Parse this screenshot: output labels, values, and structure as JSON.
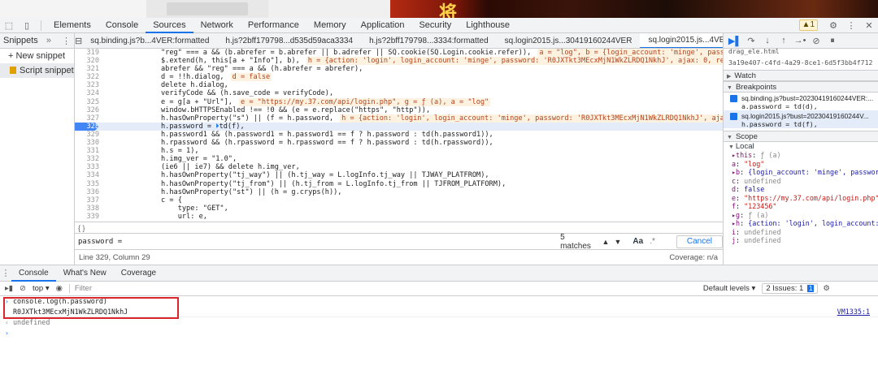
{
  "devtools": {
    "main_tabs": [
      "Elements",
      "Console",
      "Sources",
      "Network",
      "Performance",
      "Memory",
      "Application",
      "Security",
      "Lighthouse"
    ],
    "active_main_tab": "Sources",
    "warning_count": "1"
  },
  "navigator": {
    "tab_label": "Snippets",
    "new_snippet": "+ New snippet",
    "snippet_item": "Script snippet #1"
  },
  "editor": {
    "file_tabs": [
      {
        "label": "sq.binding.js?b...4VER:formatted",
        "active": false
      },
      {
        "label": "h.js?2bff179798...d535d59aca3334",
        "active": false
      },
      {
        "label": "h.js?2bff179798...3334:formatted",
        "active": false
      },
      {
        "label": "sq.login2015.js...30419160244VER",
        "active": false
      },
      {
        "label": "sq.login2015.js...4VER:formatted",
        "active": true
      }
    ],
    "code_lines": [
      {
        "ln": "319",
        "seg": [
          "\"reg\" === a && (b.abrefer = b.abrefer || b.adrefer || SQ.cookie(SQ.Login.cookie.refer)),"
        ],
        "inline": "a = \"log\", b = {login_account: 'minge', password: '1234",
        "hl": false,
        "bp": false
      },
      {
        "ln": "320",
        "seg": [
          "$.extend(h, this[a + \"Info\"], b),"
        ],
        "inline": "h = {action: 'login', login_account: 'minge', password: 'R0JXTkt3MEcxMjN1WkZLRDQ1NkhJ', ajax: 0, remember_me:",
        "hl": false,
        "bp": false
      },
      {
        "ln": "321",
        "seg": [
          "abrefer && \"reg\" === a && (h.abrefer = abrefer),"
        ],
        "inline": "",
        "hl": false,
        "bp": false
      },
      {
        "ln": "322",
        "seg": [
          "d = !!h.dialog,"
        ],
        "inline": "d = false",
        "hl": false,
        "bp": false
      },
      {
        "ln": "323",
        "seg": [
          "delete h.dialog,"
        ],
        "inline": "",
        "hl": false,
        "bp": false
      },
      {
        "ln": "324",
        "seg": [
          "verifyCode && (h.save_code = verifyCode),"
        ],
        "inline": "",
        "hl": false,
        "bp": false
      },
      {
        "ln": "325",
        "seg": [
          "e = g[a + \"Url\"],"
        ],
        "inline": "e = \"https://my.37.com/api/login.php\", g = ƒ (a), a = \"log\"",
        "hl": false,
        "bp": false
      },
      {
        "ln": "326",
        "seg": [
          "window.bHTTPSEnabled !== !0 && (e = e.replace(\"https\", \"http\")),"
        ],
        "inline": "",
        "hl": false,
        "bp": false
      },
      {
        "ln": "327",
        "seg": [
          "h.hasOwnProperty(\"s\") || (f = h.password,"
        ],
        "inline": "h = {action: 'login', login_account: 'minge', password: 'R0JXTkt3MEcxMjN1WkZLRDQ1NkhJ', ajax: 0, remem",
        "hl": false,
        "bp": false
      },
      {
        "ln": "328",
        "seg": [
          "h.password = ",
          "⏵",
          "td(f),"
        ],
        "inline": "",
        "hl": true,
        "bp": true
      },
      {
        "ln": "329",
        "seg": [
          "h.password1 && (h.password1 = h.password1 == f ? h.password : td(h.password1)),"
        ],
        "inline": "",
        "hl": false,
        "bp": false
      },
      {
        "ln": "330",
        "seg": [
          "h.rpassword && (h.rpassword = h.rpassword == f ? h.password : td(h.rpassword)),"
        ],
        "inline": "",
        "hl": false,
        "bp": false
      },
      {
        "ln": "331",
        "seg": [
          "h.s = 1),"
        ],
        "inline": "",
        "hl": false,
        "bp": false
      },
      {
        "ln": "332",
        "seg": [
          "h.img_ver = \"1.0\","
        ],
        "inline": "",
        "hl": false,
        "bp": false
      },
      {
        "ln": "333",
        "seg": [
          "(ie6 || ie7) && delete h.img_ver,"
        ],
        "inline": "",
        "hl": false,
        "bp": false
      },
      {
        "ln": "334",
        "seg": [
          "h.hasOwnProperty(\"tj_way\") || (h.tj_way = L.logInfo.tj_way || TJWAY_PLATFROM),"
        ],
        "inline": "",
        "hl": false,
        "bp": false
      },
      {
        "ln": "335",
        "seg": [
          "h.hasOwnProperty(\"tj_from\") || (h.tj_from = L.logInfo.tj_from || TJFROM_PLATFORM),"
        ],
        "inline": "",
        "hl": false,
        "bp": false
      },
      {
        "ln": "336",
        "seg": [
          "h.hasOwnProperty(\"st\") || (h = g.cryps(h)),"
        ],
        "inline": "",
        "hl": false,
        "bp": false
      },
      {
        "ln": "337",
        "seg": [
          "c = {"
        ],
        "inline": "",
        "hl": false,
        "bp": false
      },
      {
        "ln": "338",
        "seg": [
          "    type: \"GET\","
        ],
        "inline": "",
        "hl": false,
        "bp": false
      },
      {
        "ln": "339",
        "seg": [
          "    url: e,"
        ],
        "inline": "",
        "hl": false,
        "bp": false
      }
    ],
    "search_value": "password =",
    "matches": "5 matches",
    "aa": "Aa",
    "regex": ".*",
    "cancel": "Cancel",
    "cursor_position": "Line 329, Column 29",
    "coverage": "Coverage: n/a"
  },
  "debugger": {
    "top_cut": "drag_ele.html",
    "top_id": "3a19e407-c4fd-4a29-8ce1-6d5f3bb4f712",
    "watch": "Watch",
    "breakpoints": "Breakpoints",
    "bp1_file": "sq.binding.js?bust=20230419160244VER:...",
    "bp1_code": "a.password = td(d),",
    "bp2_file": "sq.login2015.js?bust=20230419160244V...",
    "bp2_code": "h.password = td(f),",
    "scope": "Scope",
    "local": "Local",
    "scope_items": [
      {
        "k": "▸this",
        "v": "ƒ (a)",
        "cls": "u"
      },
      {
        "k": "a",
        "v": "\"log\"",
        "cls": "v"
      },
      {
        "k": "▸b",
        "v": "{login_account: 'minge', password:",
        "cls": "n"
      },
      {
        "k": "c",
        "v": "undefined",
        "cls": "u"
      },
      {
        "k": "d",
        "v": "false",
        "cls": "n"
      },
      {
        "k": "e",
        "v": "\"https://my.37.com/api/login.php\"",
        "cls": "v"
      },
      {
        "k": "f",
        "v": "\"123456\"",
        "cls": "v"
      },
      {
        "k": "▸g",
        "v": "ƒ (a)",
        "cls": "u"
      },
      {
        "k": "▸h",
        "v": "{action: 'login', login_account: '",
        "cls": "n"
      },
      {
        "k": "i",
        "v": "undefined",
        "cls": "u"
      },
      {
        "k": "j",
        "v": "undefined",
        "cls": "u"
      }
    ]
  },
  "console": {
    "tabs": [
      "Console",
      "What's New",
      "Coverage"
    ],
    "context": "top ▾",
    "filter_placeholder": "Filter",
    "levels": "Default levels ▾",
    "issues": "2 Issues:",
    "issues_a": "1",
    "issues_b": "1",
    "input_cmd": "console.log(h.password)",
    "output_value": "R0JXTkt3MEcxMjN1WkZLRDQ1NkhJ",
    "output_source": "VM1335:1",
    "return_value": "undefined"
  }
}
